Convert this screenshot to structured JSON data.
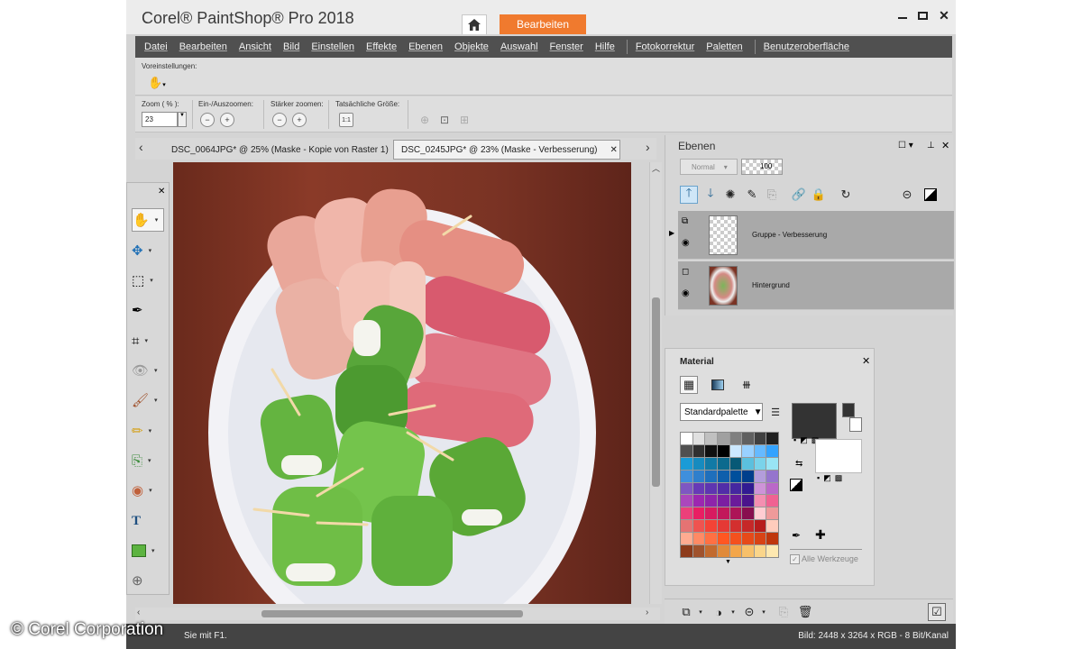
{
  "app": {
    "title": "Corel® PaintShop® Pro 2018",
    "edit_tab": "Bearbeiten"
  },
  "menu": [
    "Datei",
    "Bearbeiten",
    "Ansicht",
    "Bild",
    "Einstellen",
    "Effekte",
    "Ebenen",
    "Objekte",
    "Auswahl",
    "Fenster",
    "Hilfe",
    "Fotokorrektur",
    "Paletten",
    "Benutzeroberfläche"
  ],
  "presets": {
    "label": "Voreinstellungen:"
  },
  "tool_options": {
    "zoom_label": "Zoom ( % ):",
    "zoom_value": "23",
    "zoom_in_out_label": "Ein-/Auszoomen:",
    "more_zoom_label": "Stärker zoomen:",
    "actual_size_label": "Tatsächliche Größe:"
  },
  "documents": [
    {
      "label": "DSC_0064JPG* @  25% (Maske - Kopie von Raster 1)"
    },
    {
      "label": "DSC_0245JPG* @  23% (Maske - Verbesserung)"
    }
  ],
  "layers": {
    "title": "Ebenen",
    "blend_mode": "Normal",
    "opacity": "100",
    "items": [
      {
        "name": "Gruppe - Verbesserung"
      },
      {
        "name": "Hintergrund"
      }
    ]
  },
  "material": {
    "title": "Material",
    "palette_select": "Standardpalette",
    "all_tools_label": "Alle Werkzeuge",
    "colors": {
      "foreground": "#333333",
      "background": "#ffffff"
    }
  },
  "status": {
    "left": "Sie mit F1.",
    "right": "Bild:  2448 x 3264 x RGB - 8 Bit/Kanal"
  },
  "watermark": "© Corel Corporation",
  "theme": {
    "accent": "#f07a2e",
    "menubar": "#505050"
  }
}
